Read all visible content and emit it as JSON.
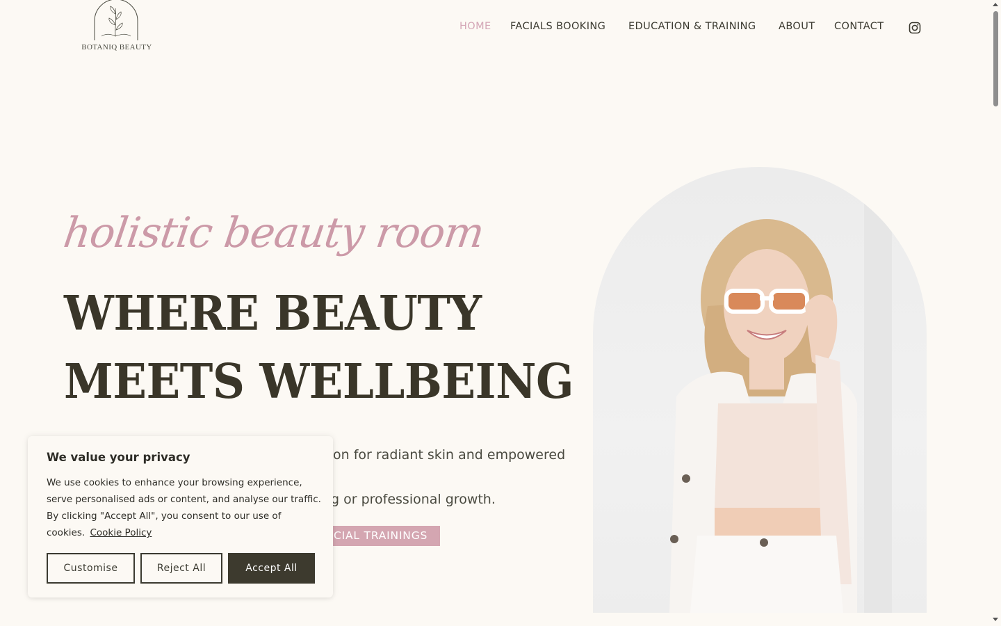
{
  "brand": {
    "logo_text": "BOTANIQ BEAUTY"
  },
  "nav": {
    "items": [
      {
        "label": "HOME",
        "active": true
      },
      {
        "label": "FACIALS BOOKING",
        "active": false
      },
      {
        "label": "EDUCATION & TRAINING",
        "active": false
      },
      {
        "label": "ABOUT",
        "active": false
      },
      {
        "label": "CONTACT",
        "active": false
      }
    ],
    "social_icon": "instagram-icon"
  },
  "hero": {
    "script_title": "holistic beauty room",
    "headline_line1": "WHERE BEAUTY",
    "headline_line2": "MEETS WELLBEING",
    "desc_line1_visible": "on for radiant skin and empowered",
    "desc_line2_visible": "g or professional growth.",
    "cta_label_visible": "CIAL TRAININGS"
  },
  "cookie": {
    "title": "We value your privacy",
    "text": "We use cookies to enhance your browsing experience, serve personalised ads or content, and analyse our traffic. By clicking \"Accept All\", you consent to our use of cookies.",
    "link": "Cookie Policy",
    "customise": "Customise",
    "reject": "Reject All",
    "accept": "Accept All"
  },
  "colors": {
    "background": "#fcf9f4",
    "accent_pink": "#d4a6b1",
    "text_dark": "#3a3629"
  }
}
